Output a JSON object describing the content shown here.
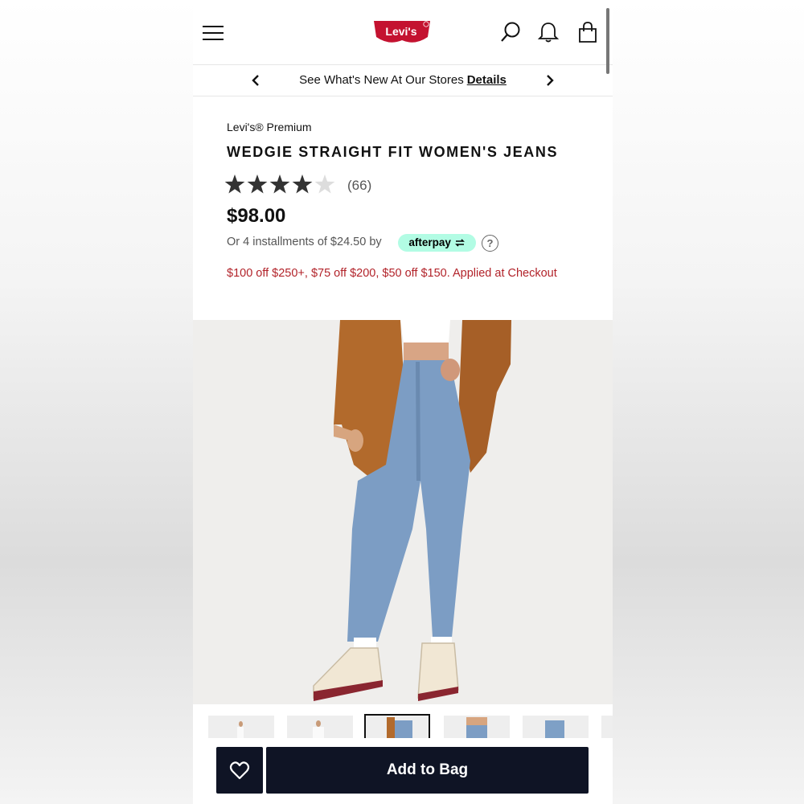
{
  "header": {
    "logo_text": "Levi's",
    "icons": [
      "menu-icon",
      "search-icon",
      "bell-icon",
      "shopping-bag-icon"
    ],
    "brand_color": "#c41230"
  },
  "promo": {
    "text": "See What's New At Our Stores",
    "link_label": "Details"
  },
  "product": {
    "brand": "Levi's® Premium",
    "title": "WEDGIE STRAIGHT FIT WOMEN'S JEANS",
    "rating": 4,
    "rating_max": 5,
    "review_count": "(66)",
    "price": "$98.00",
    "installments_text": "Or 4 installments of $24.50 by",
    "afterpay_label": "afterpay",
    "afterpay_color": "#b2fce4",
    "help_label": "?",
    "discount_text": "$100 off $250+, $75 off $200, $50 off $150. Applied at Checkout",
    "discount_color": "#b2232a"
  },
  "gallery": {
    "thumbnail_count": 6,
    "active_index": 2
  },
  "actions": {
    "wishlist_icon": "heart-icon",
    "add_label": "Add to Bag",
    "button_color": "#0f1425"
  }
}
